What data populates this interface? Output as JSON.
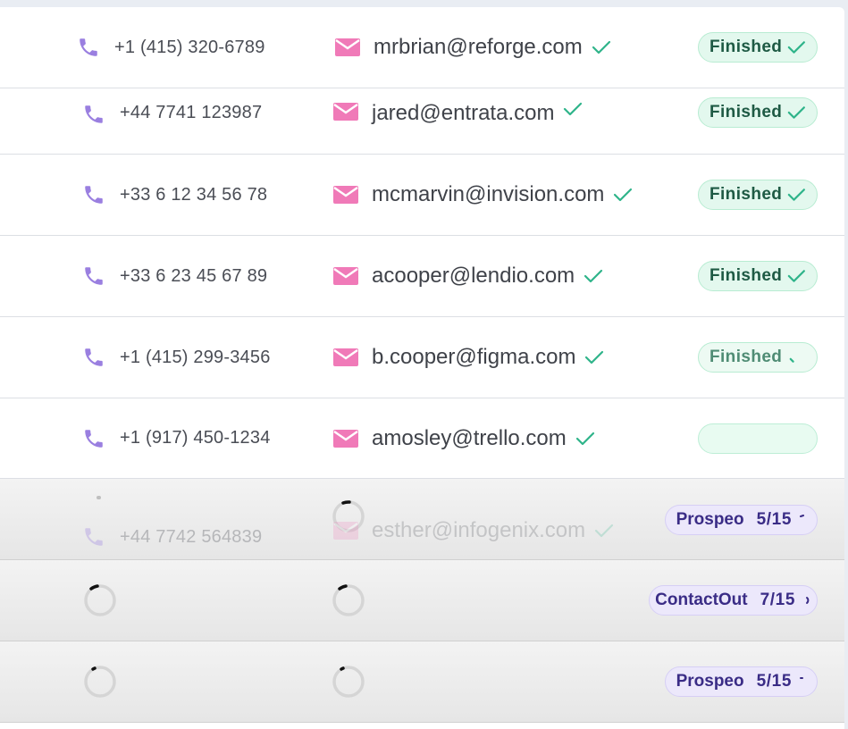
{
  "colors": {
    "phone_icon": "#9a7fe0",
    "mail_icon": "#f07ab8",
    "check": "#2fb48a",
    "finished_bg": "#e3f8ee",
    "provider_bg": "#ece8fb"
  },
  "rows": [
    {
      "phone": "+1 (415) 320-6789",
      "email": "mrbrian@reforge.com",
      "status": "Finished"
    },
    {
      "phone": "+44 7741 123987",
      "email": "jared@entrata.com",
      "status": "Finished"
    },
    {
      "phone": "+33 6 12 34 56 78",
      "email": "mcmarvin@invision.com",
      "status": "Finished"
    },
    {
      "phone": "+33 6 23 45 67 89",
      "email": "acooper@lendio.com",
      "status": "Finished"
    },
    {
      "phone": "+1 (415) 299-3456",
      "email": "b.cooper@figma.com",
      "status": "Finished"
    },
    {
      "phone": "+1 (917) 450-1234",
      "email": "amosley@trello.com",
      "status": ""
    },
    {
      "phone": "+44 7742 564839",
      "email": "esther@infogenix.com",
      "provider": "Prospeo",
      "progress": "5/15"
    },
    {
      "provider": "ContactOut",
      "progress": "7/15"
    },
    {
      "provider": "Prospeo",
      "progress": "5/15"
    }
  ]
}
